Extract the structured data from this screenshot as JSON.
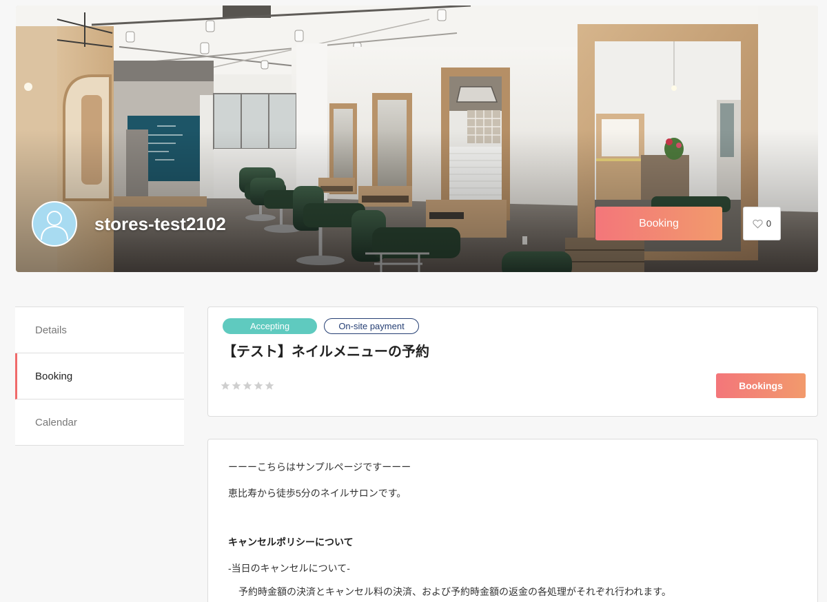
{
  "store": {
    "name": "stores-test2102",
    "booking_button": "Booking",
    "favorite_count": "0"
  },
  "sidebar": {
    "items": [
      {
        "label": "Details",
        "active": false
      },
      {
        "label": "Booking",
        "active": true
      },
      {
        "label": "Calendar",
        "active": false
      }
    ]
  },
  "menu": {
    "status_badge": "Accepting",
    "payment_badge": "On-site payment",
    "title": "【テスト】ネイルメニューの予約",
    "rating": {
      "value": 0,
      "max": 5
    },
    "bookings_button": "Bookings"
  },
  "description": {
    "intro": "ーーーこちらはサンプルページですーーー",
    "access": "恵比寿から徒歩5分のネイルサロンです。",
    "policy_heading": "キャンセルポリシーについて",
    "same_day_heading": "-当日のキャンセルについて-",
    "same_day_text": "予約時金額の決済とキャンセル料の決済、および予約時金額の返金の各処理がそれぞれ行われます。"
  },
  "icons": {
    "avatar": "user-avatar-icon",
    "favorite": "heart-icon",
    "rating": "star-icon"
  },
  "colors": {
    "accent_start": "#f3767a",
    "accent_end": "#f29a6c",
    "status_badge": "#5fcabf",
    "payment_badge": "#243e73",
    "active_indicator": "#f06a6a",
    "avatar_bg": "#a8dbf1",
    "page_bg": "#f7f7f7"
  }
}
